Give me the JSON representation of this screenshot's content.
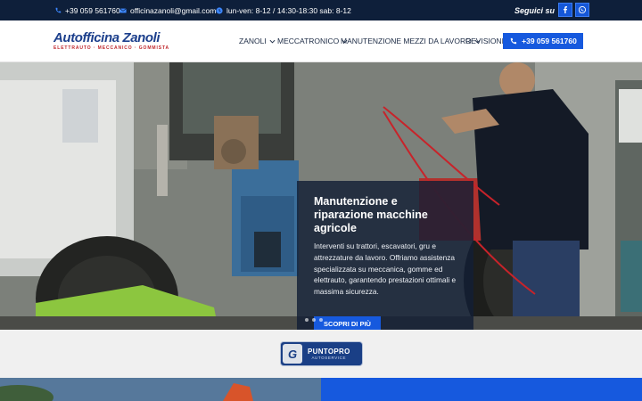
{
  "topbar": {
    "phone": "+39 059 561760",
    "email": "officinazanoli@gmail.com",
    "hours": "lun-ven: 8-12 / 14:30-18:30 sab: 8-12",
    "follow_label": "Seguici su",
    "icons": [
      "phone-icon",
      "mail-icon",
      "clock-icon",
      "facebook-icon",
      "whatsapp-icon"
    ]
  },
  "header": {
    "logo_title_a": "Autofficina",
    "logo_title_b": "Zanoli",
    "logo_subtitle": "ELETTRAUTO · MECCANICO · GOMMISTA",
    "nav": [
      {
        "label": "ZANOLI",
        "has_dropdown": true
      },
      {
        "label": "MECCATRONICO",
        "has_dropdown": true
      },
      {
        "label": "MANUTENZIONE MEZZI DA LAVORO",
        "has_dropdown": true
      },
      {
        "label": "REVISIONI",
        "has_dropdown": false
      }
    ],
    "call_button": "+39 059 561760"
  },
  "hero": {
    "title": "Manutenzione e riparazione macchine agricole",
    "text": "Interventi su trattori, escavatori, gru e attrezzature da lavoro. Offriamo assistenza specializzata su meccanica, gomme ed elettrauto, garantendo prestazioni ottimali e massima sicurezza.",
    "button": "SCOPRI DI PIÙ",
    "slides": 3
  },
  "partner": {
    "badge_letter": "G",
    "name": "PUNTOPRO",
    "tagline": "AUTOSERVICE"
  },
  "colors": {
    "topbar_bg": "#0e1f3a",
    "accent": "#1659de",
    "brand": "#1c3f8c"
  }
}
